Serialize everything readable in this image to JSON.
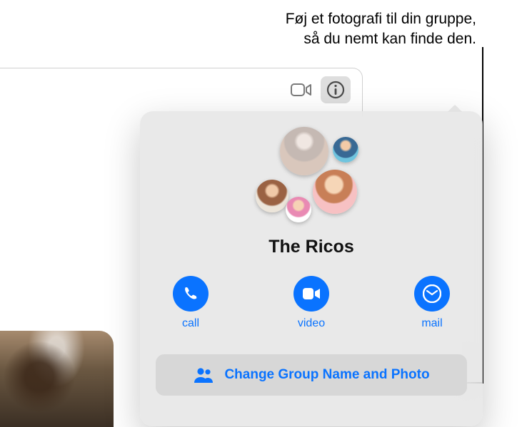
{
  "callout": {
    "line1": "Føj et fotografi til din gruppe,",
    "line2": "så du nemt kan finde den."
  },
  "toolbar": {
    "video_icon": "video-icon",
    "info_icon": "info-icon"
  },
  "popover": {
    "group_name": "The Ricos",
    "actions": {
      "call": "call",
      "video": "video",
      "mail": "mail"
    },
    "change_group": "Change Group Name and Photo"
  }
}
